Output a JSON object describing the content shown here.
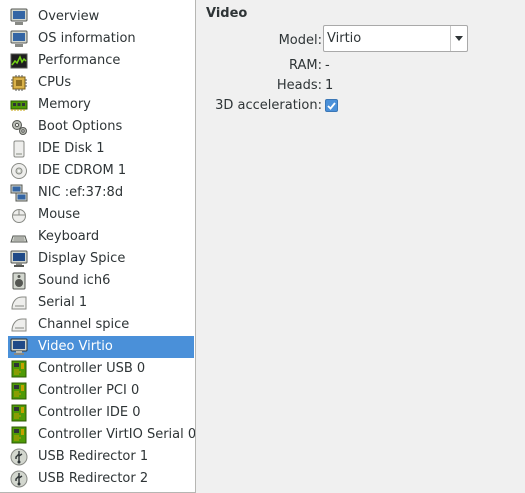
{
  "sidebar": {
    "items": [
      {
        "label": "Overview",
        "icon": "monitor-icon"
      },
      {
        "label": "OS information",
        "icon": "monitor-icon"
      },
      {
        "label": "Performance",
        "icon": "performance-graph-icon"
      },
      {
        "label": "CPUs",
        "icon": "cpu-chip-icon"
      },
      {
        "label": "Memory",
        "icon": "memory-module-icon"
      },
      {
        "label": "Boot Options",
        "icon": "gears-icon"
      },
      {
        "label": "IDE Disk 1",
        "icon": "disk-icon"
      },
      {
        "label": "IDE CDROM 1",
        "icon": "cdrom-icon"
      },
      {
        "label": "NIC :ef:37:8d",
        "icon": "network-card-icon"
      },
      {
        "label": "Mouse",
        "icon": "mouse-icon"
      },
      {
        "label": "Keyboard",
        "icon": "keyboard-icon"
      },
      {
        "label": "Display Spice",
        "icon": "display-icon"
      },
      {
        "label": "Sound ich6",
        "icon": "speaker-icon"
      },
      {
        "label": "Serial 1",
        "icon": "serial-port-icon"
      },
      {
        "label": "Channel spice",
        "icon": "channel-icon"
      },
      {
        "label": "Video Virtio",
        "icon": "video-display-icon",
        "selected": true
      },
      {
        "label": "Controller USB 0",
        "icon": "controller-board-icon"
      },
      {
        "label": "Controller PCI 0",
        "icon": "controller-board-icon"
      },
      {
        "label": "Controller IDE 0",
        "icon": "controller-board-icon"
      },
      {
        "label": "Controller VirtIO Serial 0",
        "icon": "controller-board-icon"
      },
      {
        "label": "USB Redirector 1",
        "icon": "usb-redirect-icon"
      },
      {
        "label": "USB Redirector 2",
        "icon": "usb-redirect-icon"
      }
    ]
  },
  "detail": {
    "title": "Video",
    "model_label": "Model:",
    "model_value": "Virtio",
    "ram_label": "RAM:",
    "ram_value": "-",
    "heads_label": "Heads:",
    "heads_value": "1",
    "accel_label": "3D acceleration:",
    "accel_checked": true
  },
  "colors": {
    "selection": "#4a90d9",
    "text": "#2e3436"
  }
}
